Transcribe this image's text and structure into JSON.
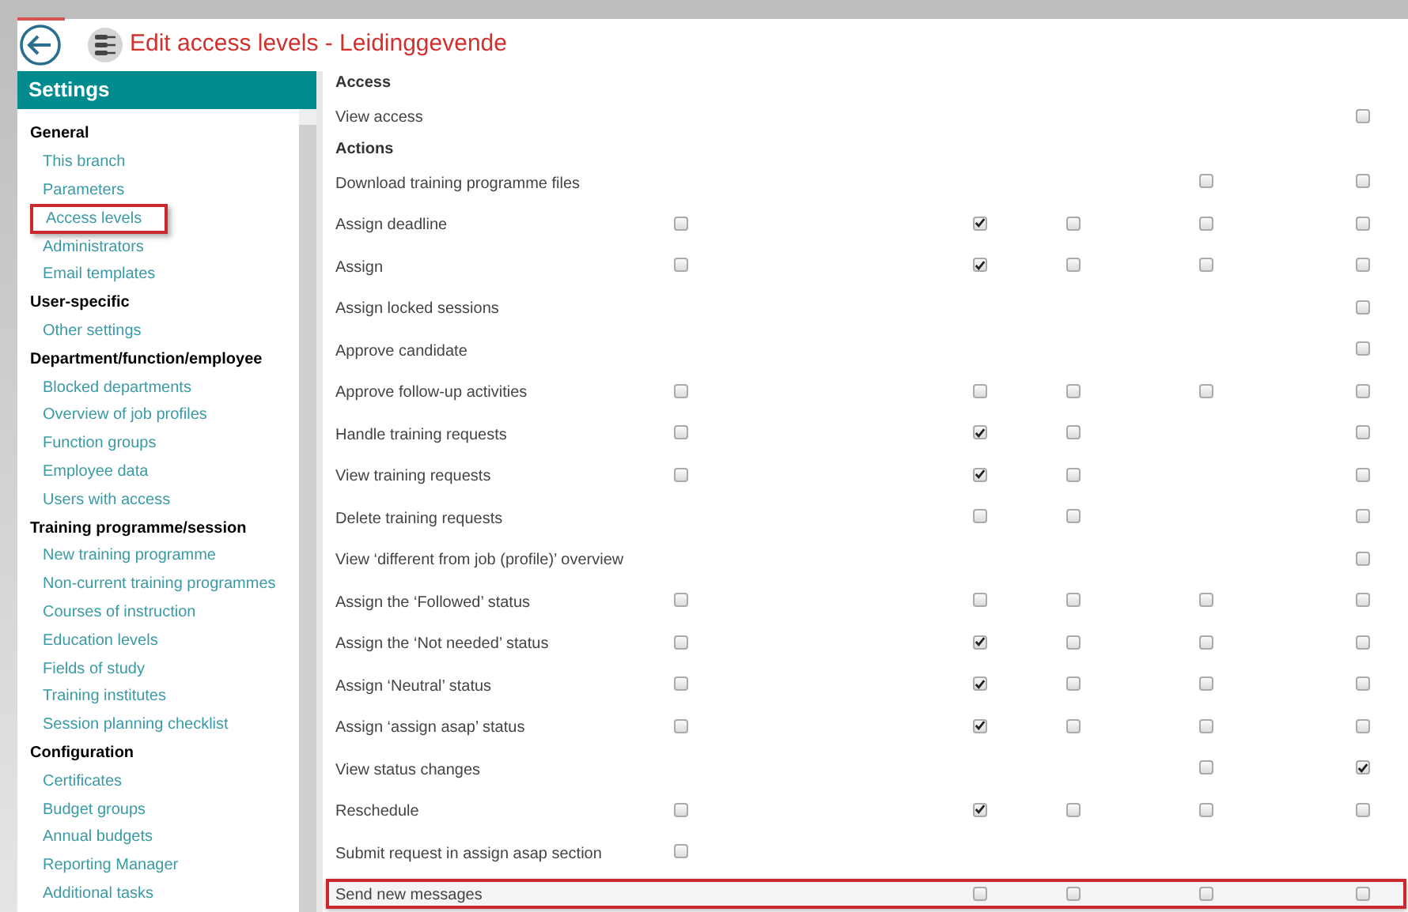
{
  "header": {
    "title": "Edit access levels - Leidinggevende"
  },
  "sidebar": {
    "title": "Settings",
    "sections": [
      {
        "title": "General",
        "items": [
          {
            "label": "This branch",
            "highlighted": false
          },
          {
            "label": "Parameters",
            "highlighted": false
          },
          {
            "label": "Access levels",
            "highlighted": true
          },
          {
            "label": "Administrators",
            "highlighted": false
          },
          {
            "label": "Email templates",
            "highlighted": false
          }
        ]
      },
      {
        "title": "User-specific",
        "items": [
          {
            "label": "Other settings",
            "highlighted": false
          }
        ]
      },
      {
        "title": "Department/function/employee",
        "items": [
          {
            "label": "Blocked departments",
            "highlighted": false
          },
          {
            "label": "Overview of job profiles",
            "highlighted": false
          },
          {
            "label": "Function groups",
            "highlighted": false
          },
          {
            "label": "Employee data",
            "highlighted": false
          },
          {
            "label": "Users with access",
            "highlighted": false
          }
        ]
      },
      {
        "title": "Training programme/session",
        "items": [
          {
            "label": "New training programme",
            "highlighted": false
          },
          {
            "label": "Non-current training programmes",
            "highlighted": false
          },
          {
            "label": "Courses of instruction",
            "highlighted": false
          },
          {
            "label": "Education levels",
            "highlighted": false
          },
          {
            "label": "Fields of study",
            "highlighted": false
          },
          {
            "label": "Training institutes",
            "highlighted": false
          },
          {
            "label": "Session planning checklist",
            "highlighted": false
          }
        ]
      },
      {
        "title": "Configuration",
        "items": [
          {
            "label": "Certificates",
            "highlighted": false
          },
          {
            "label": "Budget groups",
            "highlighted": false
          },
          {
            "label": "Annual budgets",
            "highlighted": false
          },
          {
            "label": "Reporting Manager",
            "highlighted": false
          },
          {
            "label": "Additional tasks",
            "highlighted": false
          }
        ]
      }
    ]
  },
  "rows": [
    {
      "kind": "heading",
      "label": "Access"
    },
    {
      "kind": "permission",
      "label": "View access",
      "highlighted": false,
      "cells": [
        null,
        null,
        null,
        null,
        {
          "checked": false
        }
      ]
    },
    {
      "kind": "heading",
      "label": "Actions"
    },
    {
      "kind": "permission",
      "label": "Download training programme files",
      "highlighted": false,
      "cells": [
        null,
        null,
        null,
        {
          "checked": false
        },
        {
          "checked": false
        }
      ]
    },
    {
      "kind": "permission",
      "label": "Assign deadline",
      "highlighted": false,
      "cells": [
        {
          "checked": false
        },
        {
          "checked": true
        },
        {
          "checked": false
        },
        {
          "checked": false
        },
        {
          "checked": false
        }
      ]
    },
    {
      "kind": "permission",
      "label": "Assign",
      "highlighted": false,
      "cells": [
        {
          "checked": false
        },
        {
          "checked": true
        },
        {
          "checked": false
        },
        {
          "checked": false
        },
        {
          "checked": false
        }
      ]
    },
    {
      "kind": "permission",
      "label": "Assign locked sessions",
      "highlighted": false,
      "cells": [
        null,
        null,
        null,
        null,
        {
          "checked": false
        }
      ]
    },
    {
      "kind": "permission",
      "label": "Approve candidate",
      "highlighted": false,
      "cells": [
        null,
        null,
        null,
        null,
        {
          "checked": false
        }
      ]
    },
    {
      "kind": "permission",
      "label": "Approve follow-up activities",
      "highlighted": false,
      "cells": [
        {
          "checked": false
        },
        {
          "checked": false
        },
        {
          "checked": false
        },
        {
          "checked": false
        },
        {
          "checked": false
        }
      ]
    },
    {
      "kind": "permission",
      "label": "Handle training requests",
      "highlighted": false,
      "cells": [
        {
          "checked": false
        },
        {
          "checked": true
        },
        {
          "checked": false
        },
        null,
        {
          "checked": false
        }
      ]
    },
    {
      "kind": "permission",
      "label": "View training requests",
      "highlighted": false,
      "cells": [
        {
          "checked": false
        },
        {
          "checked": true
        },
        {
          "checked": false
        },
        null,
        {
          "checked": false
        }
      ]
    },
    {
      "kind": "permission",
      "label": "Delete training requests",
      "highlighted": false,
      "cells": [
        null,
        {
          "checked": false
        },
        {
          "checked": false
        },
        null,
        {
          "checked": false
        }
      ]
    },
    {
      "kind": "permission",
      "label": "View ‘different from job (profile)’ overview",
      "highlighted": false,
      "cells": [
        null,
        null,
        null,
        null,
        {
          "checked": false
        }
      ]
    },
    {
      "kind": "permission",
      "label": "Assign the ‘Followed’ status",
      "highlighted": false,
      "cells": [
        {
          "checked": false
        },
        {
          "checked": false
        },
        {
          "checked": false
        },
        {
          "checked": false
        },
        {
          "checked": false
        }
      ]
    },
    {
      "kind": "permission",
      "label": "Assign the ‘Not needed’ status",
      "highlighted": false,
      "cells": [
        {
          "checked": false
        },
        {
          "checked": true
        },
        {
          "checked": false
        },
        {
          "checked": false
        },
        {
          "checked": false
        }
      ]
    },
    {
      "kind": "permission",
      "label": "Assign ‘Neutral’ status",
      "highlighted": false,
      "cells": [
        {
          "checked": false
        },
        {
          "checked": true
        },
        {
          "checked": false
        },
        {
          "checked": false
        },
        {
          "checked": false
        }
      ]
    },
    {
      "kind": "permission",
      "label": "Assign ‘assign asap’ status",
      "highlighted": false,
      "cells": [
        {
          "checked": false
        },
        {
          "checked": true
        },
        {
          "checked": false
        },
        {
          "checked": false
        },
        {
          "checked": false
        }
      ]
    },
    {
      "kind": "permission",
      "label": "View status changes",
      "highlighted": false,
      "cells": [
        null,
        null,
        null,
        {
          "checked": false
        },
        {
          "checked": true
        }
      ]
    },
    {
      "kind": "permission",
      "label": "Reschedule",
      "highlighted": false,
      "cells": [
        {
          "checked": false
        },
        {
          "checked": true
        },
        {
          "checked": false
        },
        {
          "checked": false
        },
        {
          "checked": false
        }
      ]
    },
    {
      "kind": "permission",
      "label": "Submit request in assign asap section",
      "highlighted": false,
      "cells": [
        {
          "checked": false
        },
        null,
        null,
        null,
        null
      ]
    },
    {
      "kind": "permission",
      "label": "Send new messages",
      "highlighted": true,
      "cells": [
        null,
        {
          "checked": false
        },
        {
          "checked": false
        },
        {
          "checked": false
        },
        {
          "checked": false
        }
      ]
    }
  ]
}
